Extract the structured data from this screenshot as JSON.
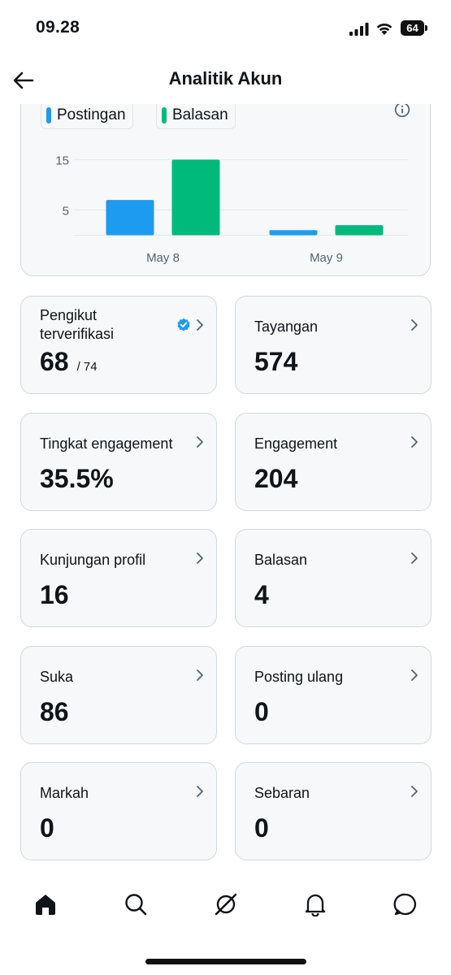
{
  "status_bar": {
    "time": "09.28",
    "battery": "64"
  },
  "header": {
    "title": "Analitik Akun",
    "back_icon": "arrow-left-icon"
  },
  "chart_data": {
    "type": "bar",
    "categories": [
      "May 8",
      "May 9"
    ],
    "series": [
      {
        "name": "Postingan",
        "color": "#1d9bf0",
        "values": [
          7,
          1
        ]
      },
      {
        "name": "Balasan",
        "color": "#00ba7c",
        "values": [
          15,
          2
        ]
      }
    ],
    "y_ticks": [
      15,
      5
    ],
    "ylim": [
      0,
      17
    ],
    "grid": true,
    "legend": "top-left"
  },
  "stats": [
    {
      "label": "Pengikut terverifikasi",
      "value": "68",
      "sub": "/ 74",
      "verified": true
    },
    {
      "label": "Tayangan",
      "value": "574"
    },
    {
      "label": "Tingkat engagement",
      "value": "35.5%"
    },
    {
      "label": "Engagement",
      "value": "204"
    },
    {
      "label": "Kunjungan profil",
      "value": "16"
    },
    {
      "label": "Balasan",
      "value": "4"
    },
    {
      "label": "Suka",
      "value": "86"
    },
    {
      "label": "Posting ulang",
      "value": "0"
    },
    {
      "label": "Markah",
      "value": "0"
    },
    {
      "label": "Sebaran",
      "value": "0"
    }
  ],
  "bottom_nav": [
    "home-icon",
    "search-icon",
    "grok-icon",
    "bell-icon",
    "message-icon"
  ],
  "colors": {
    "accent_blue": "#1d9bf0",
    "accent_green": "#00ba7c",
    "card_bg": "#f6f8f9",
    "card_border": "#cfd9de"
  }
}
